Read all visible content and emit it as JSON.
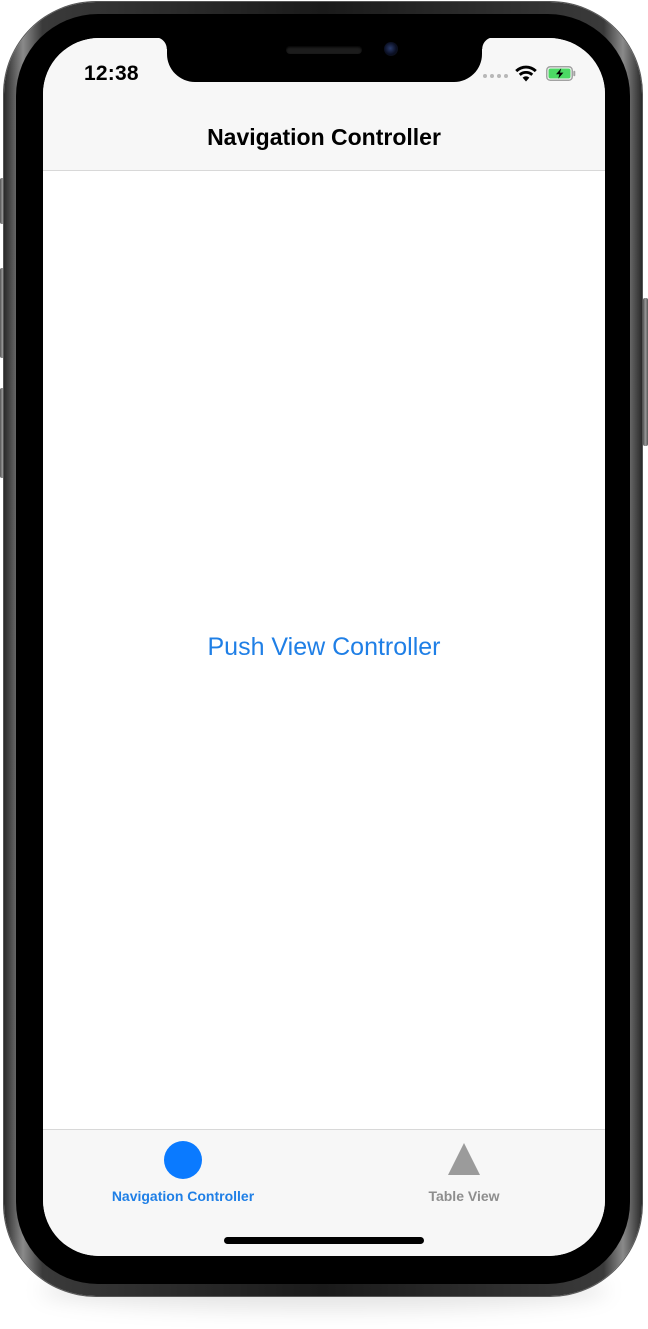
{
  "status_bar": {
    "time": "12:38",
    "wifi_icon": "wifi-icon",
    "battery_icon": "battery-charging-icon",
    "battery_color": "#4cd964"
  },
  "nav_bar": {
    "title": "Navigation Controller"
  },
  "content": {
    "push_button_label": "Push View Controller",
    "accent_color": "#1f7fe6"
  },
  "tab_bar": {
    "tabs": [
      {
        "label": "Navigation Controller",
        "icon": "circle-icon",
        "selected": true,
        "color": "#0a7aff"
      },
      {
        "label": "Table View",
        "icon": "triangle-icon",
        "selected": false,
        "color": "#9b9b9b"
      }
    ]
  }
}
